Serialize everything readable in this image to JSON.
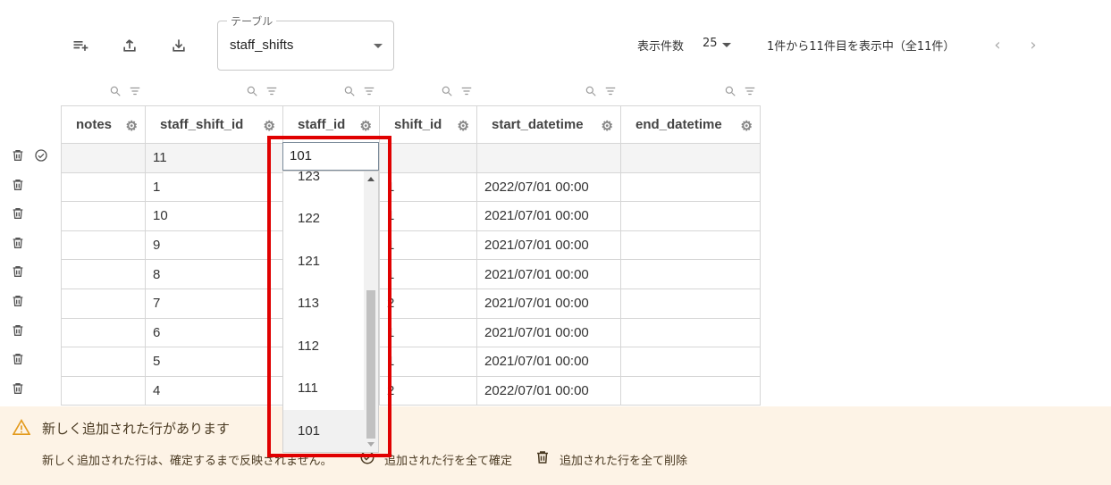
{
  "toolbar": {
    "add_row_icon": "playlist-add-icon",
    "export_icon": "upload-icon",
    "import_icon": "download-icon",
    "table_select": {
      "legend": "テーブル",
      "value": "staff_shifts"
    },
    "per_page_label": "表示件数",
    "per_page_value": "25",
    "page_info": "1件から11件目を表示中（全11件）"
  },
  "columns": [
    {
      "label": "notes"
    },
    {
      "label": "staff_shift_id"
    },
    {
      "label": "staff_id"
    },
    {
      "label": "shift_id"
    },
    {
      "label": "start_datetime"
    },
    {
      "label": "end_datetime"
    }
  ],
  "rows": [
    {
      "notes": "",
      "staff_shift_id": "11",
      "staff_id": "",
      "shift_id": "",
      "start_datetime": "",
      "end_datetime": ""
    },
    {
      "notes": "",
      "staff_shift_id": "1",
      "staff_id": "",
      "shift_id": "1",
      "start_datetime": "2022/07/01 00:00",
      "end_datetime": ""
    },
    {
      "notes": "",
      "staff_shift_id": "10",
      "staff_id": "",
      "shift_id": "1",
      "start_datetime": "2021/07/01 00:00",
      "end_datetime": ""
    },
    {
      "notes": "",
      "staff_shift_id": "9",
      "staff_id": "",
      "shift_id": "1",
      "start_datetime": "2021/07/01 00:00",
      "end_datetime": ""
    },
    {
      "notes": "",
      "staff_shift_id": "8",
      "staff_id": "",
      "shift_id": "1",
      "start_datetime": "2021/07/01 00:00",
      "end_datetime": ""
    },
    {
      "notes": "",
      "staff_shift_id": "7",
      "staff_id": "",
      "shift_id": "2",
      "start_datetime": "2021/07/01 00:00",
      "end_datetime": ""
    },
    {
      "notes": "",
      "staff_shift_id": "6",
      "staff_id": "",
      "shift_id": "1",
      "start_datetime": "2021/07/01 00:00",
      "end_datetime": ""
    },
    {
      "notes": "",
      "staff_shift_id": "5",
      "staff_id": "",
      "shift_id": "1",
      "start_datetime": "2021/07/01 00:00",
      "end_datetime": ""
    },
    {
      "notes": "",
      "staff_shift_id": "4",
      "staff_id": "",
      "shift_id": "2",
      "start_datetime": "2022/07/01 00:00",
      "end_datetime": ""
    }
  ],
  "editing_cell": {
    "value": "101"
  },
  "dropdown": {
    "options": [
      "123",
      "122",
      "121",
      "113",
      "112",
      "111",
      "101"
    ],
    "selected": "101"
  },
  "banner": {
    "title": "新しく追加された行があります",
    "description": "新しく追加された行は、確定するまで反映されません。",
    "confirm_all": "追加された行を全て確定",
    "delete_all": "追加された行を全て削除"
  },
  "colors": {
    "banner_bg": "#fdf3e6",
    "warning": "#e39a1c",
    "highlight": "#e00000"
  }
}
